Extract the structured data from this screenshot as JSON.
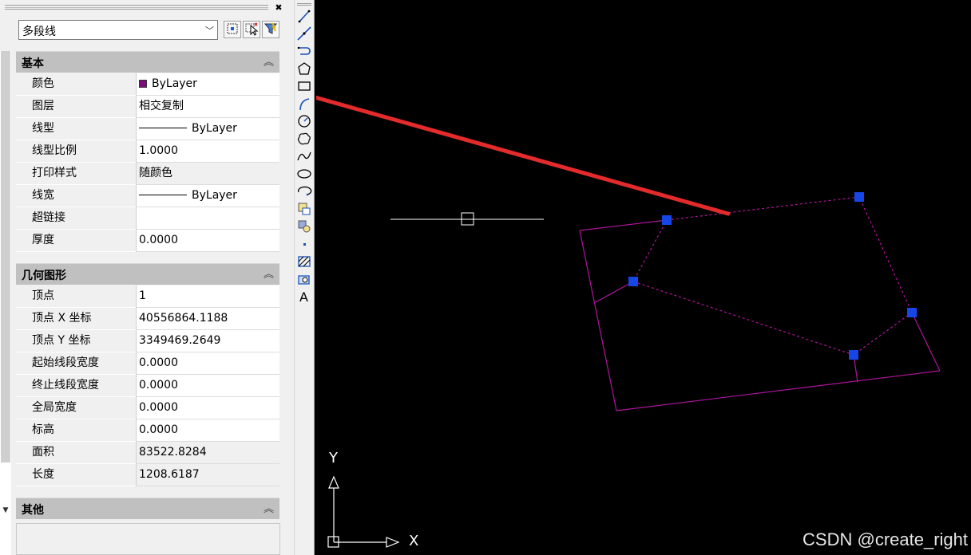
{
  "object_select": {
    "value": "多段线"
  },
  "sections": {
    "basic": {
      "title": "基本"
    },
    "geometry": {
      "title": "几何图形"
    },
    "other": {
      "title": "其他"
    }
  },
  "basic_rows": [
    {
      "label": "颜色",
      "value": "ByLayer",
      "swatch": "#7b0e7b"
    },
    {
      "label": "图层",
      "value": "相交复制"
    },
    {
      "label": "线型",
      "value": "ByLayer"
    },
    {
      "label": "线型比例",
      "value": "1.0000"
    },
    {
      "label": "打印样式",
      "value": "随颜色"
    },
    {
      "label": "线宽",
      "value": "ByLayer"
    },
    {
      "label": "超链接",
      "value": ""
    },
    {
      "label": "厚度",
      "value": "0.0000"
    }
  ],
  "geometry_rows": [
    {
      "label": "顶点",
      "value": "1"
    },
    {
      "label": "顶点 X 坐标",
      "value": "40556864.1188"
    },
    {
      "label": "顶点 Y 坐标",
      "value": "3349469.2649"
    },
    {
      "label": "起始线段宽度",
      "value": "0.0000"
    },
    {
      "label": "终止线段宽度",
      "value": "0.0000"
    },
    {
      "label": "全局宽度",
      "value": "0.0000"
    },
    {
      "label": "标高",
      "value": "0.0000"
    },
    {
      "label": "面积",
      "value": "83522.8284"
    },
    {
      "label": "长度",
      "value": "1208.6187"
    }
  ],
  "canvas": {
    "axis_y": "Y",
    "axis_x": "X",
    "watermark": "CSDN @create_right",
    "polyline_color": "#b0149c",
    "grip_color": "#1646e6",
    "arrow_color": "#e32b2b"
  },
  "icons": {
    "palette_close": "close-icon",
    "toolbar": [
      "line-icon",
      "construction-line-icon",
      "polyline-icon",
      "polygon-icon",
      "rectangle-icon",
      "arc-icon",
      "circle-icon",
      "revision-cloud-icon",
      "spline-icon",
      "ellipse-icon",
      "ellipse-arc-icon",
      "insert-block-icon",
      "make-block-icon",
      "point-icon",
      "hatch-icon",
      "region-icon",
      "text-icon"
    ]
  }
}
